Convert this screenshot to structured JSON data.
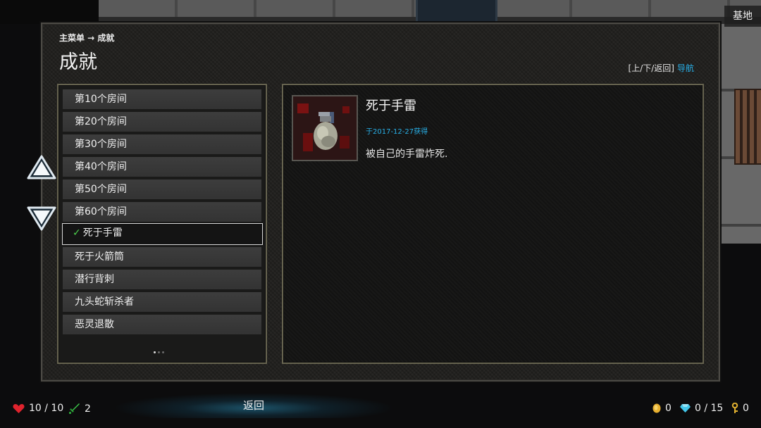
{
  "location": "基地",
  "breadcrumb": "主菜单 → 成就",
  "page_title": "成就",
  "nav_hint": {
    "keys": "[上/下/返回]",
    "action": "导航"
  },
  "achievements": [
    {
      "label": "第10个房间",
      "selected": false
    },
    {
      "label": "第20个房间",
      "selected": false
    },
    {
      "label": "第30个房间",
      "selected": false
    },
    {
      "label": "第40个房间",
      "selected": false
    },
    {
      "label": "第50个房间",
      "selected": false
    },
    {
      "label": "第60个房间",
      "selected": false
    },
    {
      "label": "死于手雷",
      "selected": true,
      "check": "✓"
    },
    {
      "label": "死于火箭筒",
      "selected": false
    },
    {
      "label": "潜行背刺",
      "selected": false
    },
    {
      "label": "九头蛇斩杀者",
      "selected": false
    },
    {
      "label": "恶灵退散",
      "selected": false
    }
  ],
  "pagination": {
    "total": 3,
    "current": 1
  },
  "detail": {
    "icon": "grenade-icon",
    "title": "死于手雷",
    "date": "于2017-12-27获得",
    "description": "被自己的手雷炸死."
  },
  "hud": {
    "health": "10 / 10",
    "attack": "2",
    "back_label": "返回",
    "gold": "0",
    "gems": "0 / 15",
    "keys": "0"
  },
  "colors": {
    "accent": "#28b0e8",
    "check": "#4cd04c",
    "heart": "#e0232d",
    "sword": "#3cc84a",
    "coin": "#e8b030",
    "gem": "#42c6ea",
    "key": "#e0b030"
  }
}
